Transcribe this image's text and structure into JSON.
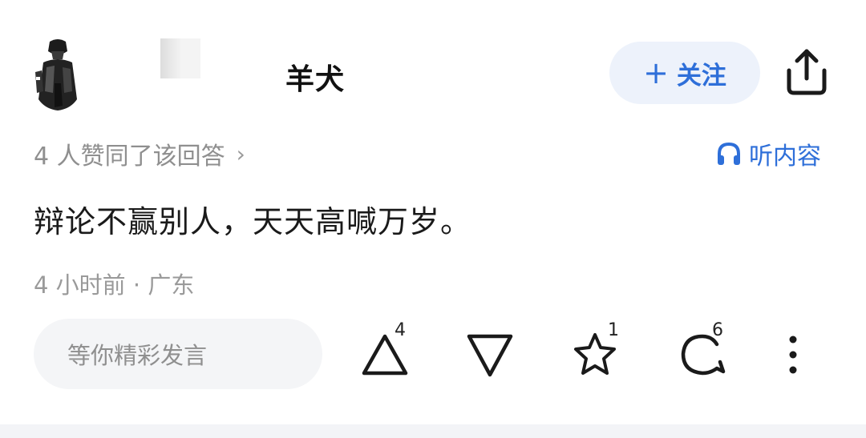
{
  "header": {
    "username_visible": "羊犬",
    "follow_label": "关注",
    "share_icon": "share-icon"
  },
  "meta": {
    "agree_text": "4 人赞同了该回答",
    "chevron": "›",
    "listen_label": "听内容"
  },
  "answer": {
    "text": "辩论不赢别人，天天高喊万岁。",
    "time_location": "4 小时前 · 广东"
  },
  "actions": {
    "comment_placeholder": "等你精彩发言",
    "upvote_count": "4",
    "favorite_count": "1",
    "comment_count": "6"
  },
  "colors": {
    "accent": "#2e6fd9",
    "follow_bg": "#edf2fb",
    "muted_text": "#8f8f8f",
    "input_bg": "#f4f5f7"
  }
}
